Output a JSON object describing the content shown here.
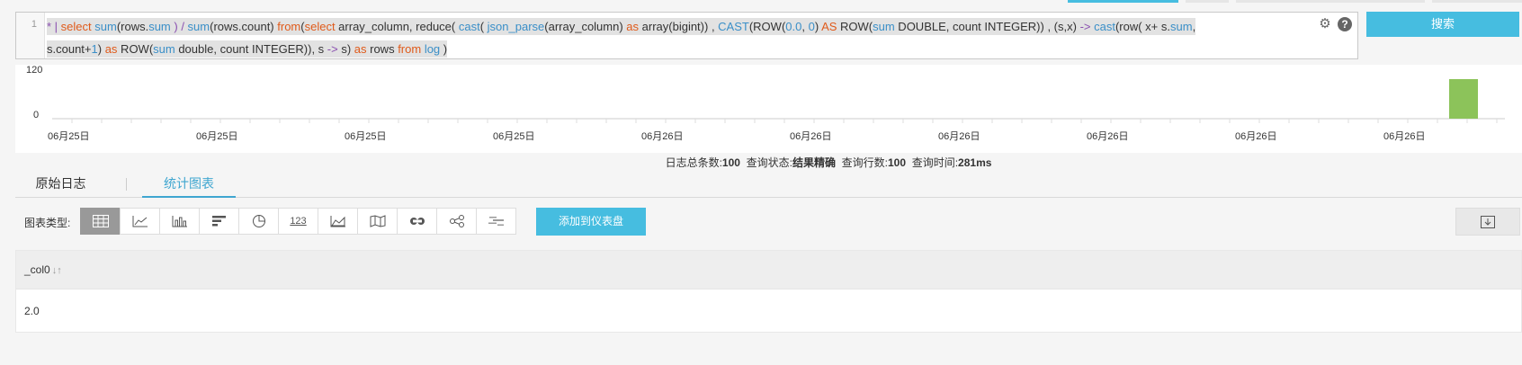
{
  "editor": {
    "line_number": "1",
    "tokens_line1": [
      {
        "t": "* | ",
        "c": "pipe"
      },
      {
        "t": " select ",
        "c": "kw"
      },
      {
        "t": " sum",
        "c": "fn"
      },
      {
        "t": "(rows.",
        "c": ""
      },
      {
        "t": "sum",
        "c": "fn"
      },
      {
        "t": " ) / ",
        "c": "op"
      },
      {
        "t": "sum",
        "c": "fn"
      },
      {
        "t": "(rows.count)  ",
        "c": ""
      },
      {
        "t": "from",
        "c": "kw"
      },
      {
        "t": "(",
        "c": ""
      },
      {
        "t": "select",
        "c": "kw"
      },
      {
        "t": "  array_column,  reduce",
        "c": ""
      },
      {
        "t": "( ",
        "c": ""
      },
      {
        "t": "cast",
        "c": "fn"
      },
      {
        "t": "(  ",
        "c": ""
      },
      {
        "t": "json_parse",
        "c": "fn"
      },
      {
        "t": "(array_column) ",
        "c": ""
      },
      {
        "t": "as",
        "c": "kw"
      },
      {
        "t": "  array(bigint))  , ",
        "c": ""
      },
      {
        "t": "CAST",
        "c": "fn"
      },
      {
        "t": "(ROW(",
        "c": ""
      },
      {
        "t": "0.0",
        "c": "num"
      },
      {
        "t": ", ",
        "c": ""
      },
      {
        "t": "0",
        "c": "num"
      },
      {
        "t": ") ",
        "c": ""
      },
      {
        "t": "AS",
        "c": "kw"
      },
      {
        "t": " ROW(",
        "c": ""
      },
      {
        "t": "sum",
        "c": "fn"
      },
      {
        "t": " DOUBLE, count INTEGER))  ,  (s,x) ",
        "c": ""
      },
      {
        "t": "->",
        "c": "op"
      },
      {
        "t": " ",
        "c": ""
      },
      {
        "t": "cast",
        "c": "fn"
      },
      {
        "t": "(row( x+ s.",
        "c": ""
      },
      {
        "t": "sum",
        "c": "fn"
      },
      {
        "t": ",",
        "c": ""
      }
    ],
    "tokens_line2": [
      {
        "t": "s.count+",
        "c": ""
      },
      {
        "t": "1",
        "c": "num"
      },
      {
        "t": ") ",
        "c": ""
      },
      {
        "t": "as",
        "c": "kw"
      },
      {
        "t": " ROW(",
        "c": ""
      },
      {
        "t": "sum",
        "c": "fn"
      },
      {
        "t": " double, count INTEGER)), s ",
        "c": ""
      },
      {
        "t": "->",
        "c": "op"
      },
      {
        "t": " s)  ",
        "c": ""
      },
      {
        "t": "as",
        "c": "kw"
      },
      {
        "t": " rows ",
        "c": ""
      },
      {
        "t": "from",
        "c": "kw"
      },
      {
        "t": " ",
        "c": ""
      },
      {
        "t": "log",
        "c": "fn"
      },
      {
        "t": " )",
        "c": ""
      }
    ],
    "settings_icon": "gear-icon",
    "help_icon": "?",
    "search_label": "搜索"
  },
  "histogram": {
    "y_ticks": [
      "120",
      "0"
    ],
    "x_labels": [
      "06月25日",
      "06月25日",
      "06月25日",
      "06月25日",
      "06月26日",
      "06月26日",
      "06月26日",
      "06月26日",
      "06月26日",
      "06月26日"
    ],
    "bar_count": 100,
    "bar_max": 120,
    "bar_color": "#8cc35a"
  },
  "status": {
    "total_label": "日志总条数:",
    "total_value": "100",
    "state_label": "查询状态:",
    "state_value": "结果精确",
    "rows_label": "查询行数:",
    "rows_value": "100",
    "time_label": "查询时间:",
    "time_value": "281ms"
  },
  "tabs": [
    {
      "label": "原始日志"
    },
    {
      "label": "统计图表"
    }
  ],
  "toolbar": {
    "type_label": "图表类型:",
    "add_label": "添加到仪表盘",
    "chart_types": [
      "table-icon",
      "line-chart-icon",
      "bar-chart-icon",
      "horizontal-bar-icon",
      "pie-chart-icon",
      "number-icon",
      "area-chart-icon",
      "map-icon",
      "flow-icon",
      "graph-icon",
      "word-cloud-icon"
    ],
    "number_glyph": "123"
  },
  "table": {
    "column": "_col0",
    "rows": [
      [
        "2.0"
      ]
    ]
  },
  "colors": {
    "accent": "#46bde0",
    "tab_active": "#3fa6d0",
    "keyword": "#e05a1a",
    "function": "#3a8fc8"
  }
}
